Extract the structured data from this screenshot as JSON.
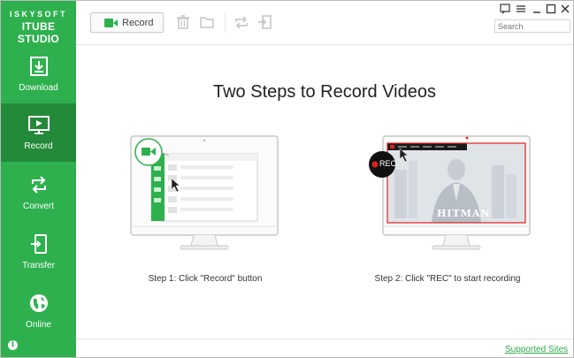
{
  "brand": {
    "line1": "ISKYSOFT",
    "line2": "ITUBE STUDIO"
  },
  "sidebar": {
    "items": [
      {
        "label": "Download",
        "icon": "download-icon"
      },
      {
        "label": "Record",
        "icon": "monitor-record-icon",
        "active": true
      },
      {
        "label": "Convert",
        "icon": "convert-icon"
      },
      {
        "label": "Transfer",
        "icon": "transfer-icon"
      },
      {
        "label": "Online",
        "icon": "globe-icon"
      }
    ]
  },
  "toolbar": {
    "record_label": "Record",
    "search_placeholder": "Search"
  },
  "main": {
    "headline": "Two Steps to Record Videos",
    "step1": "Step 1: Click \"Record\" button",
    "step2": "Step 2: Click \"REC\" to start recording",
    "rec_badge": "REC",
    "movie_title": "HITMAN"
  },
  "footer": {
    "supported_sites": "Supported Sites"
  },
  "colors": {
    "brand_green": "#2fb04f",
    "active_green": "#238a3a",
    "rec_red": "#e02020"
  }
}
